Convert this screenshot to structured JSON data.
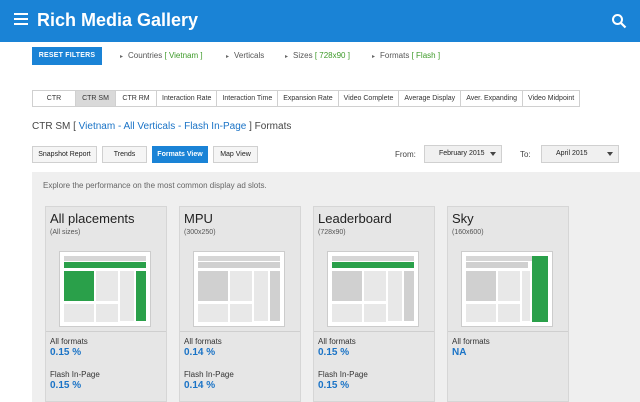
{
  "app": {
    "title": "Rich Media Gallery"
  },
  "filters": {
    "reset_label": "RESET FILTERS",
    "countries_label": "Countries",
    "countries_value": "[ Vietnam ]",
    "verticals_label": "Verticals",
    "sizes_label": "Sizes",
    "sizes_value": "[ 728x90 ]",
    "formats_label": "Formats",
    "formats_value": "[ Flash ]"
  },
  "tabs": [
    "CTR",
    "CTR SM",
    "CTR RM",
    "Interaction Rate",
    "Interaction Time",
    "Expansion Rate",
    "Video Complete",
    "Average Display",
    "Aver. Expanding",
    "Video Midpoint"
  ],
  "active_tab": "CTR SM",
  "heading": {
    "prefix": "CTR SM [",
    "link": " Vietnam - All Verticals - Flash In-Page ",
    "suffix": "] Formats"
  },
  "views": [
    "Snapshot Report",
    "Trends",
    "Formats View",
    "Map View"
  ],
  "active_view": "Formats View",
  "dates": {
    "from_label": "From:",
    "from_value": "February 2015",
    "to_label": "To:",
    "to_value": "April 2015"
  },
  "intro": "Explore the performance on the most common display ad slots.",
  "cards": [
    {
      "title": "All placements",
      "size": "(All sizes)",
      "all_formats_label": "All formats",
      "all_formats_value": "0.15 %",
      "flash_label": "Flash In-Page",
      "flash_value": "0.15 %"
    },
    {
      "title": "MPU",
      "size": "(300x250)",
      "all_formats_label": "All formats",
      "all_formats_value": "0.14 %",
      "flash_label": "Flash In-Page",
      "flash_value": "0.14 %"
    },
    {
      "title": "Leaderboard",
      "size": "(728x90)",
      "all_formats_label": "All formats",
      "all_formats_value": "0.15 %",
      "flash_label": "Flash In-Page",
      "flash_value": "0.15 %"
    },
    {
      "title": "Sky",
      "size": "(160x600)",
      "all_formats_label": "All formats",
      "all_formats_value": "NA"
    }
  ],
  "colors": {
    "brand": "#1a83d6",
    "ad_slot": "#2aa04a",
    "value_blue": "#1a73c6",
    "filter_value": "#3d9a29"
  },
  "icons": {
    "menu": "hamburger-icon",
    "search": "search-icon"
  }
}
